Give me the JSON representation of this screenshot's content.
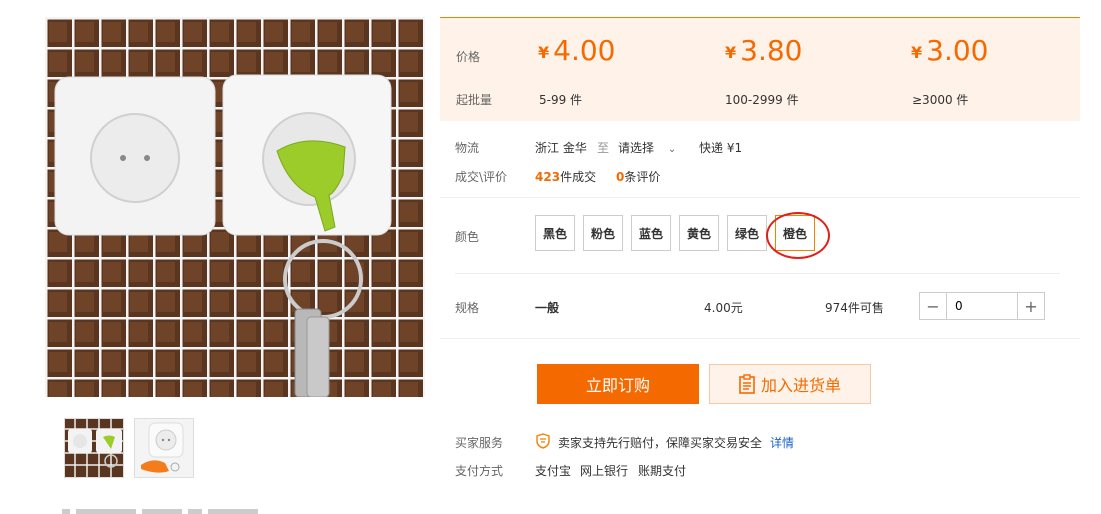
{
  "price_box": {
    "price_label": "价格",
    "moq_label": "起批量",
    "tiers": [
      {
        "yen": "¥",
        "price": "4.00",
        "range": "5-99 件"
      },
      {
        "yen": "¥",
        "price": "3.80",
        "range": "100-2999 件"
      },
      {
        "yen": "¥",
        "price": "3.00",
        "range": "≥3000 件"
      }
    ]
  },
  "logistics": {
    "label": "物流",
    "origin": "浙江 金华",
    "to": "至",
    "destination_select": "请选择",
    "shipping": "快递 ¥1"
  },
  "sales": {
    "label": "成交\\评价",
    "deals_count": "423",
    "deals_text": "件成交",
    "reviews_count": "0",
    "reviews_text": "条评价"
  },
  "color": {
    "label": "颜色",
    "options": [
      "黑色",
      "粉色",
      "蓝色",
      "黄色",
      "绿色",
      "橙色"
    ],
    "selected": "橙色"
  },
  "spec": {
    "label": "规格",
    "name": "一般",
    "price": "4.00元",
    "stock": "974件可售",
    "quantity": "0"
  },
  "actions": {
    "buy_now": "立即订购",
    "add_to_cart": "加入进货单"
  },
  "service": {
    "label": "买家服务",
    "text": "卖家支持先行赔付，保障买家交易安全",
    "link": "详情"
  },
  "payment": {
    "label": "支付方式",
    "methods": [
      "支付宝",
      "网上银行",
      "账期支付"
    ]
  },
  "colors": {
    "accent": "#f56a00",
    "price_bg": "#fff2e8",
    "highlight_circle": "#e0201a",
    "link": "#1a64c8"
  }
}
